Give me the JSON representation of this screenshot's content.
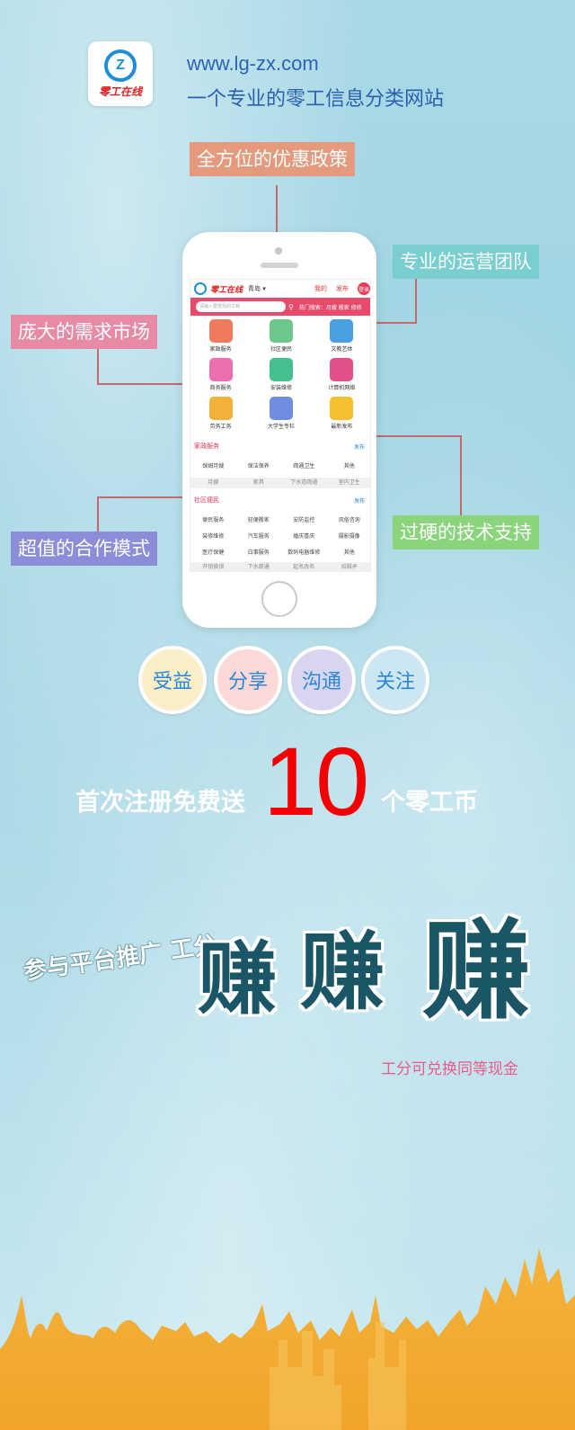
{
  "header": {
    "logo_text": "零工在线",
    "url": "www.lg-zx.com",
    "tagline": "一个专业的零工信息分类网站"
  },
  "callouts": {
    "policy": "全方位的优惠政策",
    "team": "专业的运营团队",
    "market": "庞大的需求市场",
    "tech": "过硬的技术支持",
    "coop": "超值的合作模式"
  },
  "phone": {
    "logo": "零工在线",
    "city": "青岛 ▾",
    "links": [
      "我的",
      "发布",
      "登录"
    ],
    "search_placeholder": "请输入要查找的工种",
    "hot_search": "热门搜索：月嫂  搬家  修修",
    "grid": [
      "家政服务",
      "社区便民",
      "文教艺体",
      "商务服务",
      "安装维修",
      "计算机网络",
      "劳务工务",
      "大学生专栏",
      "最新发布"
    ],
    "sections": [
      {
        "title": "家政服务",
        "publish": "发布",
        "rows": [
          [
            "保姆月嫂",
            "保洁保养",
            "疏通卫生",
            "其他"
          ],
          [
            "月嫂",
            "家具",
            "下水道疏通",
            "室内卫生"
          ]
        ]
      },
      {
        "title": "社区便民",
        "publish": "发布",
        "rows": [
          [
            "便民服务",
            "轻便搬家",
            "安防监控",
            "风俗咨询"
          ],
          [
            "装修维修",
            "汽车服务",
            "婚庆喜庆",
            "摄影摄像"
          ],
          [
            "医疗保健",
            "白事服务",
            "数码电器维修",
            "其他"
          ],
          [
            "开锁换锁",
            "下水疏通",
            "起名改名",
            "招贼矛"
          ]
        ]
      }
    ]
  },
  "bubbles": [
    "受益",
    "分享",
    "沟通",
    "关注"
  ],
  "register": {
    "left": "首次注册免费送",
    "number": "10",
    "right": "个零工币"
  },
  "earn": {
    "small": "参与平台推广 工分",
    "big": [
      "赚",
      "赚",
      "赚"
    ],
    "note": "工分可兑换同等现金"
  },
  "colors": {
    "accent_red": "#f40000",
    "brand_blue": "#1d8fd8",
    "earn_text": "#1b5667"
  }
}
